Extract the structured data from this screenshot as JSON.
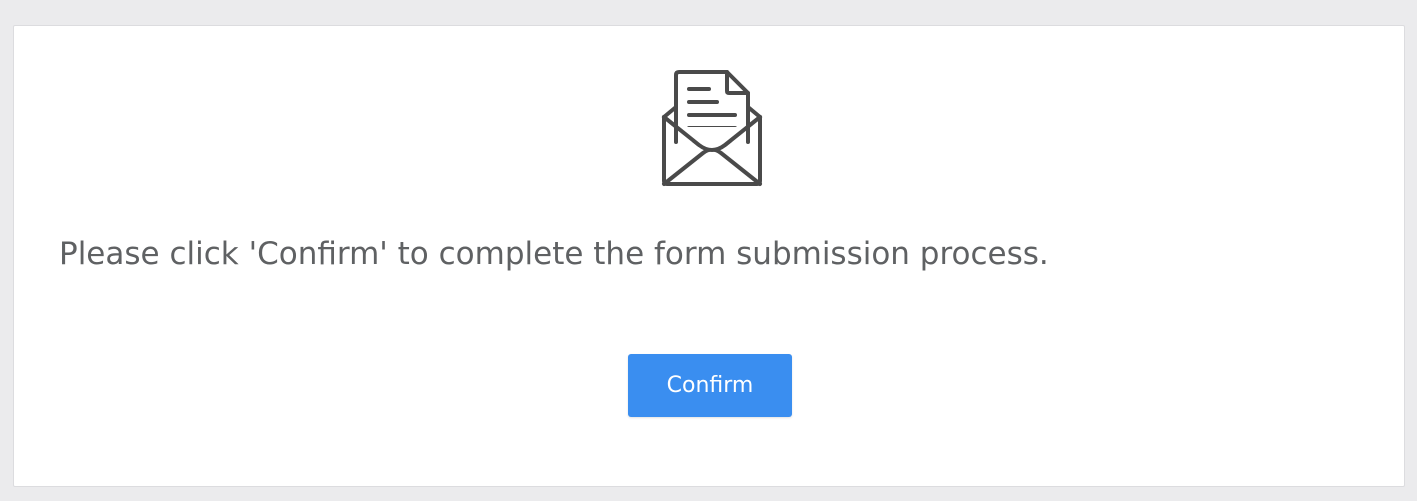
{
  "dialog": {
    "icon": "envelope-letter-icon",
    "message": "Please click 'Confirm' to complete the form submission process.",
    "confirm_label": "Confirm"
  },
  "colors": {
    "background": "#ebebed",
    "card": "#ffffff",
    "text": "#5f6163",
    "icon": "#4a4a4a",
    "button": "#3a8ef0",
    "button_text": "#ffffff"
  }
}
